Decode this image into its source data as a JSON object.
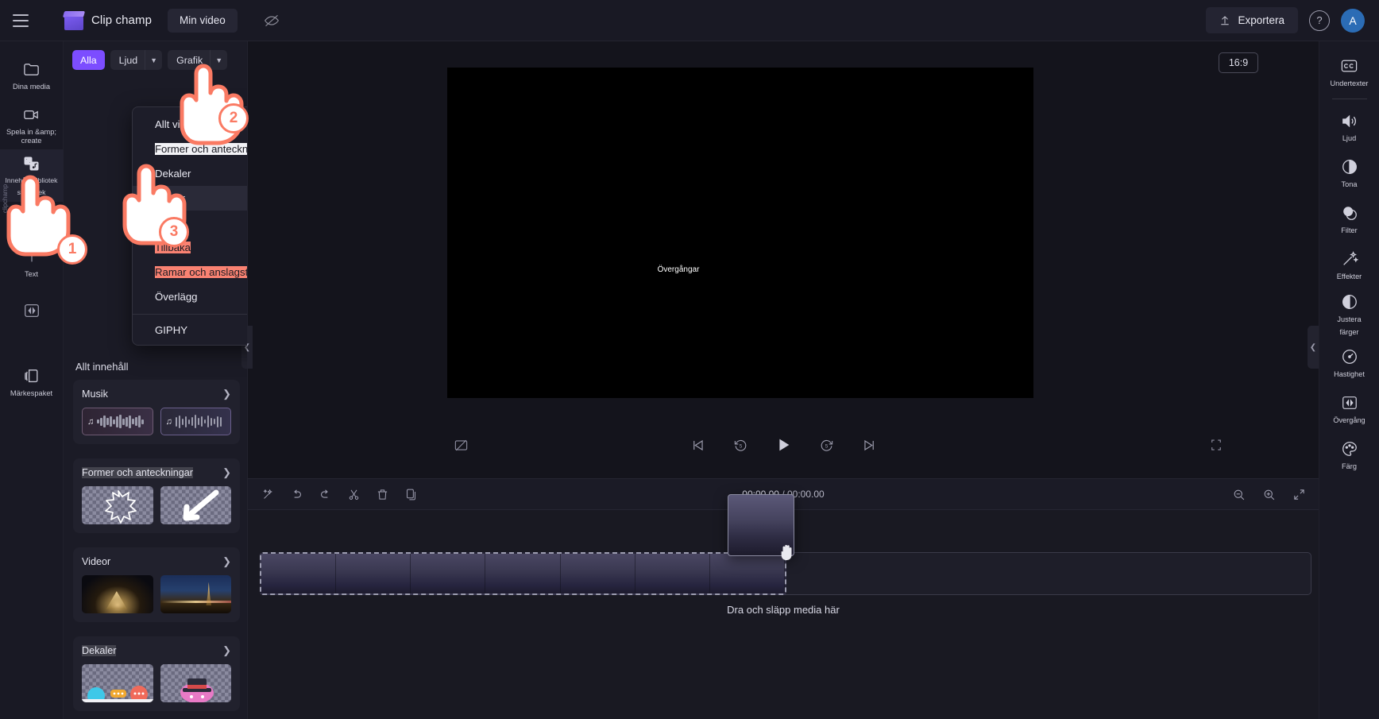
{
  "header": {
    "menu_icon": "hamburger-icon",
    "brand": "Clip champ",
    "project_chip": "Min video",
    "eye_icon": "eye-off-icon",
    "export_label": "Exportera",
    "export_icon": "upload-icon",
    "help_icon": "question-circle-icon",
    "avatar_initial": "A"
  },
  "left_rail": {
    "items": [
      {
        "label": "Dina media",
        "icon": "folder-icon",
        "active": false
      },
      {
        "label": "Spela in &amp; create",
        "icon": "video-camera-icon",
        "active": false
      },
      {
        "label": "Innehållsbibliotek sbibliotek",
        "label_line1": "Innehållsbibliotek",
        "label_line2": "sbibliotek",
        "icon": "content-library-icon",
        "active": true
      },
      {
        "label": "Text",
        "icon": "text-icon",
        "active": false
      },
      {
        "label": "",
        "icon": "transitions-icon",
        "active": false
      },
      {
        "label": "Märkespaket",
        "icon": "brand-kit-icon",
        "active": false
      }
    ]
  },
  "panel": {
    "filters": [
      {
        "label": "Alla",
        "type": "solid",
        "caret": false
      },
      {
        "label": "Ljud",
        "type": "split",
        "caret": true
      },
      {
        "label": "Grafik",
        "type": "split",
        "caret": true
      }
    ],
    "section_title": "Allt innehåll",
    "cards": [
      {
        "title": "Musik",
        "highlight": false,
        "chevron": "chevron-right-icon",
        "thumbs": [
          {
            "kind": "audio",
            "name": "audio-thumb-1"
          },
          {
            "kind": "audio2",
            "name": "audio-thumb-2"
          }
        ]
      },
      {
        "title": "Former och anteckningar",
        "highlight": true,
        "chevron": "chevron-right-icon",
        "thumbs": [
          {
            "kind": "shape-burst",
            "name": "shape-burst-thumb"
          },
          {
            "kind": "shape-arrow",
            "name": "shape-arrow-thumb"
          }
        ]
      },
      {
        "title": "Videor",
        "highlight": false,
        "chevron": "chevron-right-icon",
        "thumbs": [
          {
            "kind": "louvre",
            "name": "video-thumb-louvre"
          },
          {
            "kind": "eiffel",
            "name": "video-thumb-eiffel"
          }
        ]
      },
      {
        "title": "Dekaler",
        "highlight": true,
        "chevron": "chevron-right-icon",
        "thumbs": [
          {
            "kind": "sticker-faces",
            "name": "sticker-thumb-1"
          },
          {
            "kind": "sticker-hat",
            "name": "sticker-thumb-2"
          }
        ]
      }
    ]
  },
  "dropdown": {
    "items": [
      {
        "label": "Allt visuellt innehåll",
        "state": "normal"
      },
      {
        "label": "Former och anteckningar",
        "state": "box-white"
      },
      {
        "label": "Dekaler",
        "state": "normal"
      },
      {
        "label": "Videor",
        "state": "selected"
      },
      {
        "label": "Bilder",
        "state": "normal"
      },
      {
        "label": "Tillbaka",
        "state": "box-red"
      },
      {
        "label": "Ramar och anslagstavla",
        "state": "box-red"
      },
      {
        "label": "Överlägg",
        "state": "normal"
      },
      {
        "label": "GIPHY",
        "state": "normal",
        "after_separator": true
      }
    ]
  },
  "preview": {
    "ratio_badge": "16:9",
    "overlay_text": "Övergångar",
    "controls": {
      "snapshot_icon": "snapshot-off-icon",
      "skip_start_icon": "skip-to-start-icon",
      "rewind_icon": "rewind-5s-icon",
      "play_icon": "play-icon",
      "forward_icon": "forward-5s-icon",
      "skip_end_icon": "skip-to-end-icon",
      "fullscreen_icon": "fullscreen-icon"
    },
    "collapse_left_icon": "chevron-left-icon",
    "collapse_right_icon": "chevron-left-icon"
  },
  "timeline": {
    "tools": [
      {
        "icon": "magic-wand-icon",
        "name": "auto-compose-button"
      },
      {
        "icon": "undo-icon",
        "name": "undo-button"
      },
      {
        "icon": "redo-icon",
        "name": "redo-button"
      },
      {
        "icon": "scissors-icon",
        "name": "split-button"
      },
      {
        "icon": "trash-icon",
        "name": "delete-button"
      },
      {
        "icon": "duplicate-icon",
        "name": "duplicate-button"
      }
    ],
    "current_time": "00:00.00",
    "time_separator": " / ",
    "total_time": "00:00.00",
    "zoom_out_icon": "zoom-out-icon",
    "zoom_in_icon": "zoom-in-icon",
    "fit_icon": "fit-to-screen-icon",
    "drop_hint": "Dra och släpp media här"
  },
  "right_rail": {
    "items": [
      {
        "label": "Undertexter",
        "icon": "closed-caption-icon",
        "separator_after": true
      },
      {
        "label": "Ljud",
        "icon": "speaker-icon",
        "separator_after": false
      },
      {
        "label": "Tona",
        "icon": "fade-icon",
        "separator_after": false
      },
      {
        "label": "Filter",
        "icon": "filter-circles-icon",
        "separator_after": false
      },
      {
        "label": "Effekter",
        "icon": "magic-wand-sparkle-icon",
        "separator_after": false
      },
      {
        "label": "Justera färger",
        "label_line1": "Justera",
        "label_line2": "färger",
        "icon": "contrast-icon",
        "separator_after": false
      },
      {
        "label": "Hastighet",
        "icon": "speedometer-icon",
        "separator_after": false
      },
      {
        "label": "Övergång",
        "icon": "transition-icon",
        "separator_after": false
      },
      {
        "label": "Färg",
        "icon": "palette-icon",
        "separator_after": false
      }
    ]
  },
  "tutorial": {
    "steps": [
      {
        "number": "1"
      },
      {
        "number": "2"
      },
      {
        "number": "3"
      }
    ]
  },
  "colors": {
    "accent": "#7c4dff",
    "tutorial": "#fa7a63",
    "panel_bg": "#1b1b26",
    "app_bg": "#14141c",
    "header_bg": "#191924",
    "avatar": "#2b6cb5"
  }
}
